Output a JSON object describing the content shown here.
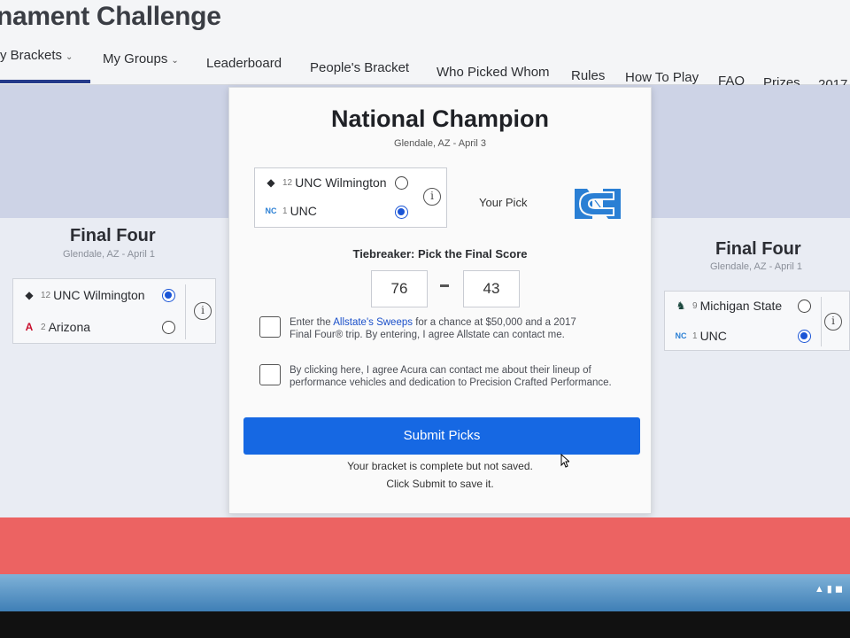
{
  "header": {
    "title": "nament Challenge",
    "nav": [
      {
        "label": "y Brackets",
        "has_dropdown": true
      },
      {
        "label": "My Groups",
        "has_dropdown": true
      },
      {
        "label": "Leaderboard"
      },
      {
        "label": "People's Bracket"
      },
      {
        "label": "Who Picked Whom"
      },
      {
        "label": "Rules"
      },
      {
        "label": "How To Play"
      },
      {
        "label": "FAQ"
      },
      {
        "label": "Prizes"
      },
      {
        "label": "2017"
      }
    ],
    "chevron": "⌄"
  },
  "left_panel": {
    "title": "Final Four",
    "subtitle": "Glendale, AZ - April 1",
    "teams": [
      {
        "seed": "12",
        "name": "UNC Wilmington",
        "selected": true
      },
      {
        "seed": "2",
        "name": "Arizona",
        "selected": false
      }
    ]
  },
  "right_panel": {
    "title": "Final Four",
    "subtitle": "Glendale, AZ - April 1",
    "teams": [
      {
        "seed": "9",
        "name": "Michigan State",
        "selected": false
      },
      {
        "seed": "1",
        "name": "UNC",
        "selected": true
      }
    ]
  },
  "modal": {
    "title": "National Champion",
    "subtitle": "Glendale, AZ - April 3",
    "teams": [
      {
        "seed": "12",
        "name": "UNC Wilmington",
        "selected": false
      },
      {
        "seed": "1",
        "name": "UNC",
        "selected": true
      }
    ],
    "your_pick_label": "Your Pick",
    "tiebreaker_label": "Tiebreaker: Pick the Final Score",
    "score_1": "76",
    "score_2": "43",
    "sweeps_prefix": "Enter the ",
    "sweeps_link": "Allstate's Sweeps",
    "sweeps_suffix": " for a chance at $50,000 and a 2017",
    "sweeps_line2": "Final Four® trip. By entering, I agree Allstate can contact me.",
    "acura_text": "By clicking here, I agree Acura can contact me about their lineup of performance vehicles and dedication to Precision Crafted Performance.",
    "submit_label": "Submit Picks",
    "status_1": "Your bracket is complete but not saved.",
    "status_2": "Click Submit to save it."
  },
  "icons": {
    "info": "i",
    "unc_logo": "NC"
  },
  "colors": {
    "accent_blue": "#1668e3",
    "nav_underline": "#243a8a",
    "red_band": "#ec6362",
    "carolina_blue": "#2a7fd4"
  }
}
